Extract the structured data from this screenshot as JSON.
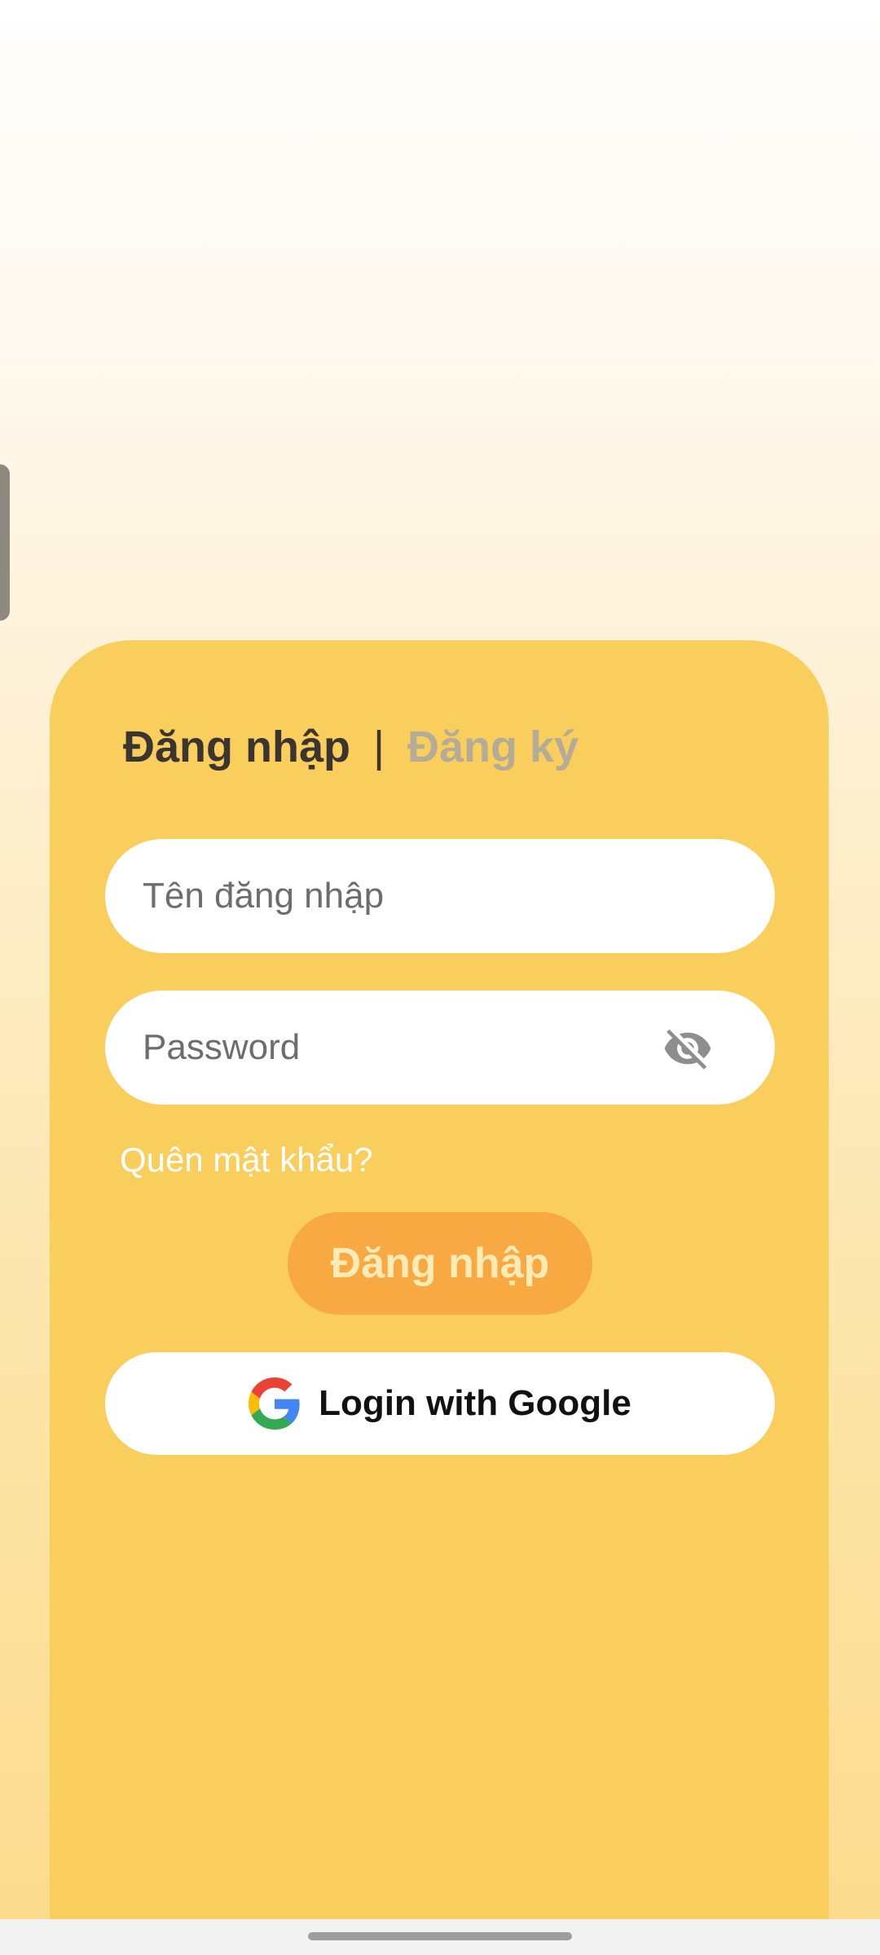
{
  "tabs": {
    "login": "Đăng nhập",
    "separator": "|",
    "register": "Đăng ký"
  },
  "username_field": {
    "value": "",
    "placeholder": "Tên đăng nhập"
  },
  "password_field": {
    "value": "",
    "placeholder": "Password",
    "visibility_icon": "eye-off-icon"
  },
  "forgot_password": "Quên mật khẩu?",
  "login_button": "Đăng nhập",
  "google_button": {
    "label": "Login with Google",
    "icon": "google-logo-icon"
  },
  "colors": {
    "card": "#F9CE5C",
    "login_button": "#F9A941",
    "active_tab": "#3A3530",
    "inactive_tab": "#B4AC97"
  }
}
